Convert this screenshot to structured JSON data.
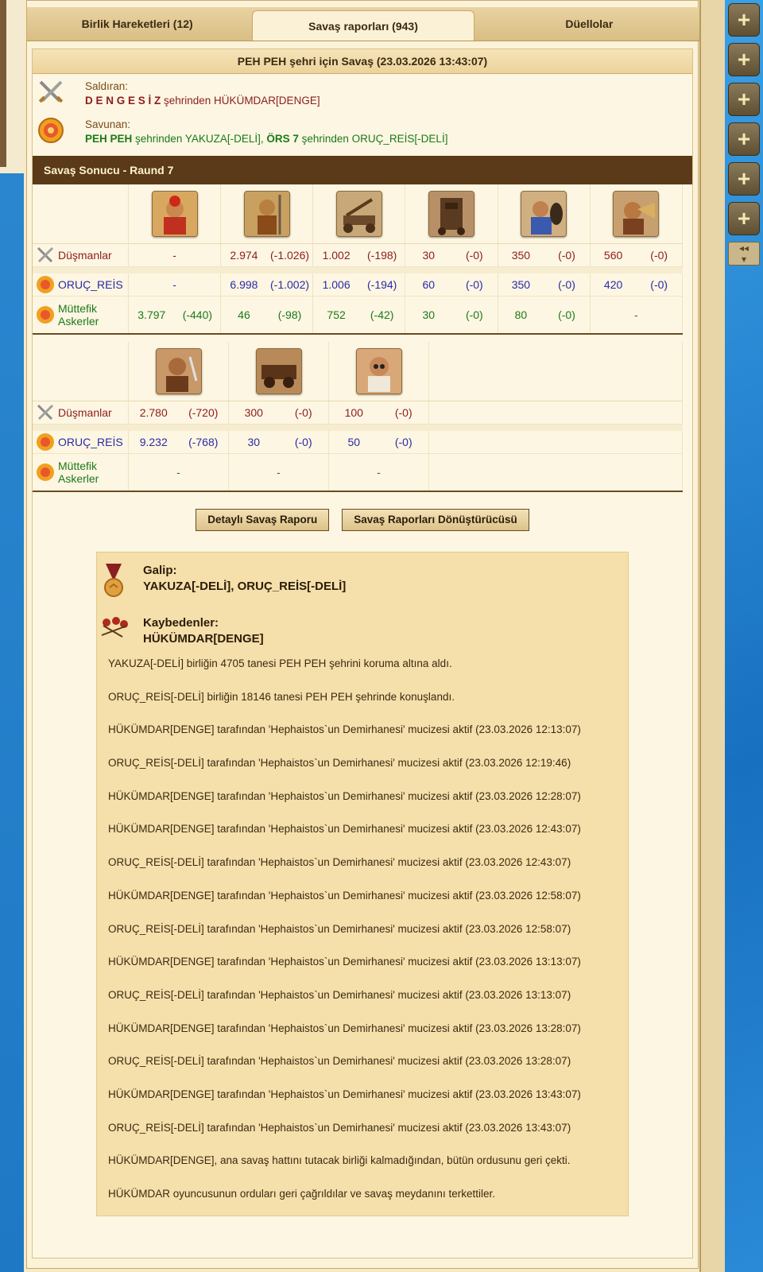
{
  "tabs": [
    {
      "label": "Birlik Hareketleri (12)"
    },
    {
      "label": "Savaş raporları (943)"
    },
    {
      "label": "Düellolar"
    }
  ],
  "report": {
    "title": "PEH PEH şehri için Savaş (23.03.2026 13:43:07)",
    "attacker_label": "Saldıran:",
    "attacker_city": "D E N G E S İ Z",
    "attacker_from": " şehrinden HÜKÜMDAR[DENGE]",
    "defender_label": "Savunan:",
    "def_city1": "PEH PEH",
    "def_from1": " şehrinden YAKUZA[-DELİ], ",
    "def_city2": "ÖRS 7",
    "def_from2": " şehrinden ORUÇ_REİS[-DELİ]",
    "section_title": "Savaş Sonucu - Raund 7"
  },
  "rows": {
    "enemies": "Düşmanlar",
    "owner": "ORUÇ_REİS",
    "allies": "Müttefik Askerler"
  },
  "table1": {
    "enemies": [
      [
        "-",
        ""
      ],
      [
        "2.974",
        "(-1.026)"
      ],
      [
        "1.002",
        "(-198)"
      ],
      [
        "30",
        "(-0)"
      ],
      [
        "350",
        "(-0)"
      ],
      [
        "560",
        "(-0)"
      ]
    ],
    "owner": [
      [
        "-",
        ""
      ],
      [
        "6.998",
        "(-1.002)"
      ],
      [
        "1.006",
        "(-194)"
      ],
      [
        "60",
        "(-0)"
      ],
      [
        "350",
        "(-0)"
      ],
      [
        "420",
        "(-0)"
      ]
    ],
    "allies": [
      [
        "3.797",
        "(-440)"
      ],
      [
        "46",
        "(-98)"
      ],
      [
        "752",
        "(-42)"
      ],
      [
        "30",
        "(-0)"
      ],
      [
        "80",
        "(-0)"
      ],
      [
        "-",
        ""
      ]
    ]
  },
  "table2": {
    "enemies": [
      [
        "2.780",
        "(-720)"
      ],
      [
        "300",
        "(-0)"
      ],
      [
        "100",
        "(-0)"
      ]
    ],
    "owner": [
      [
        "9.232",
        "(-768)"
      ],
      [
        "30",
        "(-0)"
      ],
      [
        "50",
        "(-0)"
      ]
    ],
    "allies": [
      [
        "-",
        ""
      ],
      [
        "-",
        ""
      ],
      [
        "-",
        ""
      ]
    ]
  },
  "buttons": {
    "detailed": "Detaylı Savaş Raporu",
    "converter": "Savaş Raporları Dönüştürücüsü"
  },
  "result": {
    "winner_label": "Galip:",
    "winners": "YAKUZA[-DELİ], ORUÇ_REİS[-DELİ]",
    "loser_label": "Kaybedenler:",
    "losers": "HÜKÜMDAR[DENGE]",
    "logs": [
      "YAKUZA[-DELİ] birliğin 4705 tanesi PEH PEH şehrini koruma altına aldı.",
      "ORUÇ_REİS[-DELİ] birliğin 18146 tanesi PEH PEH şehrinde konuşlandı.",
      "HÜKÜMDAR[DENGE] tarafından 'Hephaistos`un Demirhanesi' mucizesi aktif (23.03.2026 12:13:07)",
      "ORUÇ_REİS[-DELİ] tarafından 'Hephaistos`un Demirhanesi' mucizesi aktif (23.03.2026 12:19:46)",
      "HÜKÜMDAR[DENGE] tarafından 'Hephaistos`un Demirhanesi' mucizesi aktif (23.03.2026 12:28:07)",
      "HÜKÜMDAR[DENGE] tarafından 'Hephaistos`un Demirhanesi' mucizesi aktif (23.03.2026 12:43:07)",
      "ORUÇ_REİS[-DELİ] tarafından 'Hephaistos`un Demirhanesi' mucizesi aktif (23.03.2026 12:43:07)",
      "HÜKÜMDAR[DENGE] tarafından 'Hephaistos`un Demirhanesi' mucizesi aktif (23.03.2026 12:58:07)",
      "ORUÇ_REİS[-DELİ] tarafından 'Hephaistos`un Demirhanesi' mucizesi aktif (23.03.2026 12:58:07)",
      "HÜKÜMDAR[DENGE] tarafından 'Hephaistos`un Demirhanesi' mucizesi aktif (23.03.2026 13:13:07)",
      "ORUÇ_REİS[-DELİ] tarafından 'Hephaistos`un Demirhanesi' mucizesi aktif (23.03.2026 13:13:07)",
      "HÜKÜMDAR[DENGE] tarafından 'Hephaistos`un Demirhanesi' mucizesi aktif (23.03.2026 13:28:07)",
      "ORUÇ_REİS[-DELİ] tarafından 'Hephaistos`un Demirhanesi' mucizesi aktif (23.03.2026 13:28:07)",
      "HÜKÜMDAR[DENGE] tarafından 'Hephaistos`un Demirhanesi' mucizesi aktif (23.03.2026 13:43:07)",
      "ORUÇ_REİS[-DELİ] tarafından 'Hephaistos`un Demirhanesi' mucizesi aktif (23.03.2026 13:43:07)",
      "HÜKÜMDAR[DENGE], ana savaş hattını tutacak birliği kalmadığından, bütün ordusunu geri çekti.",
      "HÜKÜMDAR oyuncusunun orduları geri çağrıldılar ve savaş meydanını terkettiler."
    ]
  },
  "colors": {
    "attacker": "#8b1e1e",
    "defender": "#1b7a1b",
    "owner": "#2a2aa8",
    "section_bar": "#5a3a18"
  }
}
